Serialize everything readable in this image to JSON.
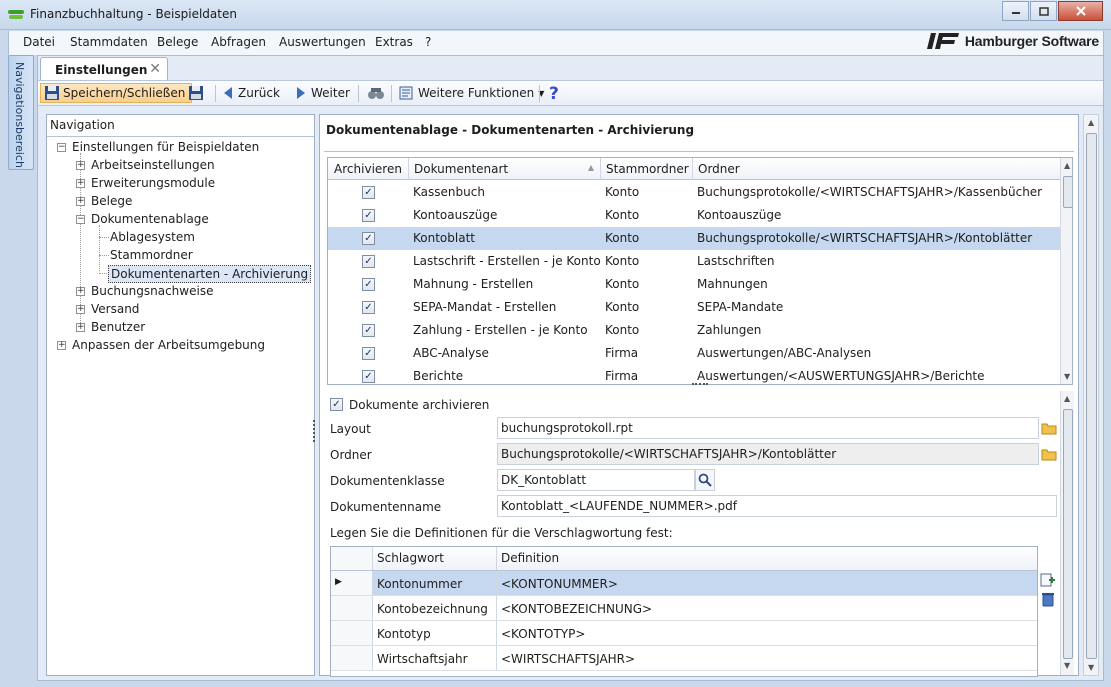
{
  "window": {
    "title": "Finanzbuchhaltung - Beispieldaten"
  },
  "menu": {
    "items": [
      "Datei",
      "Stammdaten",
      "Belege",
      "Abfragen",
      "Auswertungen",
      "Extras",
      "?"
    ],
    "brand": "Hamburger Software"
  },
  "sidetab": {
    "label": "Navigationsbereich"
  },
  "doctab": {
    "label": "Einstellungen"
  },
  "toolbar": {
    "save_close": "Speichern/Schließen",
    "back": "Zurück",
    "forward": "Weiter",
    "more_functions": "Weitere Funktionen"
  },
  "navigation": {
    "header": "Navigation",
    "root": "Einstellungen für Beispieldaten",
    "items": [
      "Arbeitseinstellungen",
      "Erweiterungsmodule",
      "Belege",
      "Dokumentenablage",
      "Ablagesystem",
      "Stammordner",
      "Dokumentenarten - Archivierung",
      "Buchungsnachweise",
      "Versand",
      "Benutzer"
    ],
    "root2": "Anpassen der Arbeitsumgebung"
  },
  "main": {
    "title": "Dokumentenablage - Dokumentenarten - Archivierung",
    "columns": [
      "Archivieren",
      "Dokumentenart",
      "Stammordner",
      "Ordner"
    ],
    "rows": [
      {
        "archive": "✓",
        "doc": "Kassenbuch",
        "root": "Konto",
        "folder": "Buchungsprotokolle/<WIRTSCHAFTSJAHR>/Kassenbücher"
      },
      {
        "archive": "✓",
        "doc": "Kontoauszüge",
        "root": "Konto",
        "folder": "Kontoauszüge"
      },
      {
        "archive": "✓",
        "doc": "Kontoblatt",
        "root": "Konto",
        "folder": "Buchungsprotokolle/<WIRTSCHAFTSJAHR>/Kontoblätter"
      },
      {
        "archive": "✓",
        "doc": "Lastschrift - Erstellen - je Konto",
        "root": "Konto",
        "folder": "Lastschriften"
      },
      {
        "archive": "✓",
        "doc": "Mahnung - Erstellen",
        "root": "Konto",
        "folder": "Mahnungen"
      },
      {
        "archive": "✓",
        "doc": "SEPA-Mandat - Erstellen",
        "root": "Konto",
        "folder": "SEPA-Mandate"
      },
      {
        "archive": "✓",
        "doc": "Zahlung - Erstellen - je Konto",
        "root": "Konto",
        "folder": "Zahlungen"
      },
      {
        "archive": "✓",
        "doc": "ABC-Analyse",
        "root": "Firma",
        "folder": "Auswertungen/ABC-Analysen"
      },
      {
        "archive": "✓",
        "doc": "Berichte",
        "root": "Firma",
        "folder": "Auswertungen/<AUSWERTUNGSJAHR>/Berichte"
      }
    ]
  },
  "detail": {
    "archive_checkbox": "Dokumente archivieren",
    "archive_mark": "✓",
    "layout_label": "Layout",
    "layout_value": "buchungsprotokoll.rpt",
    "folder_label": "Ordner",
    "folder_value": "Buchungsprotokolle/<WIRTSCHAFTSJAHR>/Kontoblätter",
    "class_label": "Dokumentenklasse",
    "class_value": "DK_Kontoblatt",
    "name_label": "Dokumentenname",
    "name_value": "Kontoblatt_<LAUFENDE_NUMMER>.pdf",
    "keyword_hint": "Legen Sie die Definitionen für die Verschlagwortung fest:",
    "keyword_columns": [
      "Schlagwort",
      "Definition"
    ],
    "keywords": [
      {
        "keyword": "Kontonummer",
        "definition": "<KONTONUMMER>"
      },
      {
        "keyword": "Kontobezeichnung",
        "definition": "<KONTOBEZEICHNUNG>"
      },
      {
        "keyword": "Kontotyp",
        "definition": "<KONTOTYP>"
      },
      {
        "keyword": "Wirtschaftsjahr",
        "definition": "<WIRTSCHAFTSJAHR>"
      }
    ]
  }
}
